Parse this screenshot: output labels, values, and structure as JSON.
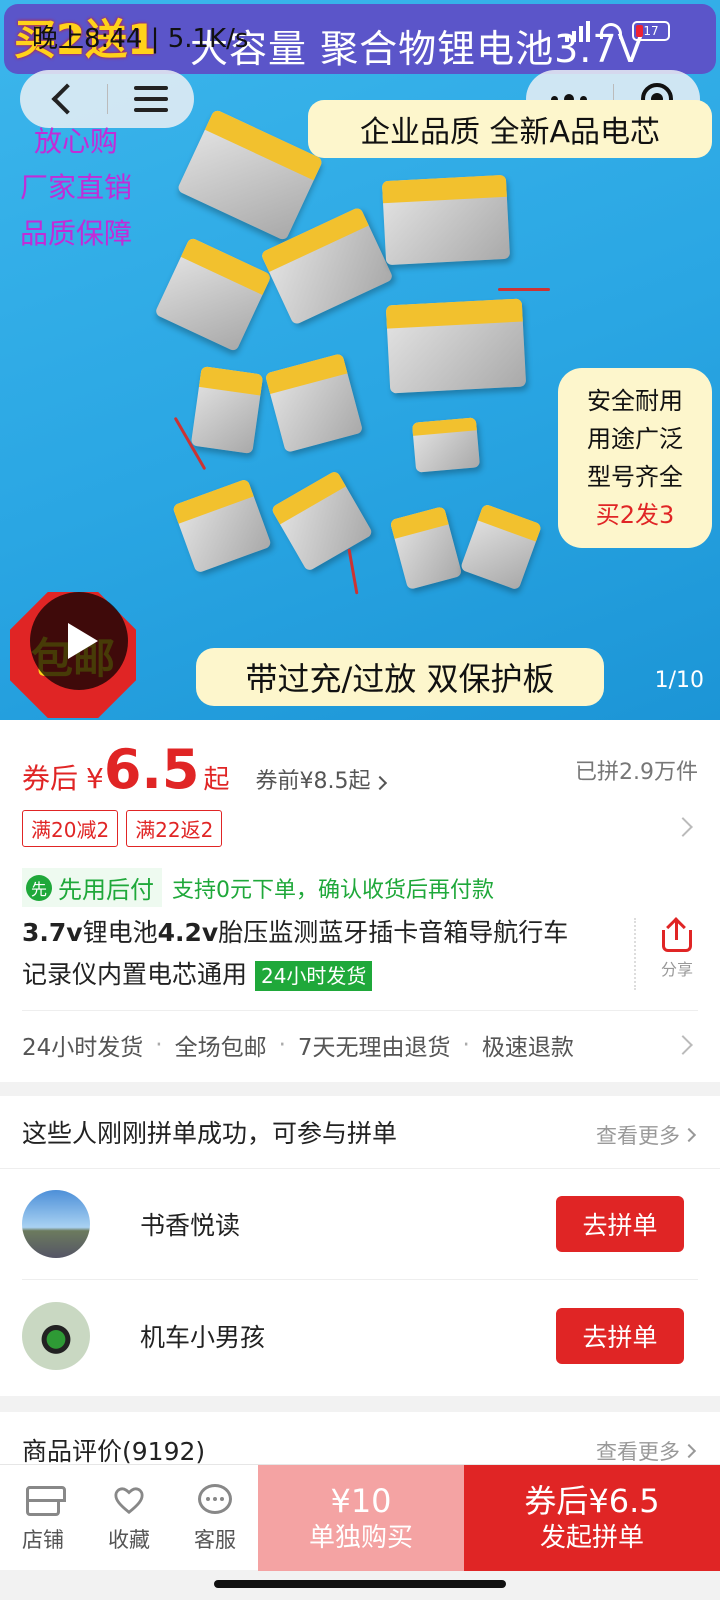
{
  "status_bar": {
    "time": "晚上8:44",
    "speed": "5.1K/s",
    "battery": "17"
  },
  "hero": {
    "promo_big": "买2送1",
    "title": "大容量 聚合物锂电池3.7V",
    "quality_banner": "企业品质 全新A品电芯",
    "side_promos": [
      "放心购",
      "厂家直销",
      "品质保障"
    ],
    "right_badge": [
      "安全耐用",
      "用途广泛",
      "型号齐全",
      "买2发3"
    ],
    "bottom_banner": "带过充/过放 双保护板",
    "free_shipping": "包邮",
    "counter": "1/10"
  },
  "price": {
    "after_label": "券后",
    "currency": "¥",
    "value": "6.5",
    "suffix": "起",
    "before": "券前¥8.5起",
    "sold": "已拼2.9万件"
  },
  "coupons": [
    "满20减2",
    "满22返2"
  ],
  "paylater": {
    "icon_text": "先",
    "label": "先用后付",
    "desc": "支持0元下单，确认收货后再付款"
  },
  "product": {
    "title_part1": "3.7v",
    "title_part2": "锂电池",
    "title_part3": "4.2v",
    "title_part4": "胎压监测蓝牙插卡音箱导航行车记录仪内置电芯通用",
    "ship_badge": "24小时发货"
  },
  "share_label": "分享",
  "services": [
    "24小时发货",
    "全场包邮",
    "7天无理由退货",
    "极速退款"
  ],
  "group": {
    "title": "这些人刚刚拼单成功，可参与拼单",
    "more": "查看更多",
    "members": [
      {
        "name": "书香悦读",
        "button": "去拼单"
      },
      {
        "name": "机车小男孩",
        "button": "去拼单"
      }
    ]
  },
  "reviews": {
    "title": "商品评价(9192)",
    "more": "查看更多"
  },
  "action_bar": {
    "store": "店铺",
    "favorite": "收藏",
    "service": "客服",
    "alone_price": "¥10",
    "alone_text": "单独购买",
    "group_price": "券后¥6.5",
    "group_text": "发起拼单"
  },
  "colors": {
    "accent": "#e02525",
    "green": "#1fa83a",
    "hero_sky": "#2aa6e3",
    "title_bar": "#5b55c9"
  }
}
